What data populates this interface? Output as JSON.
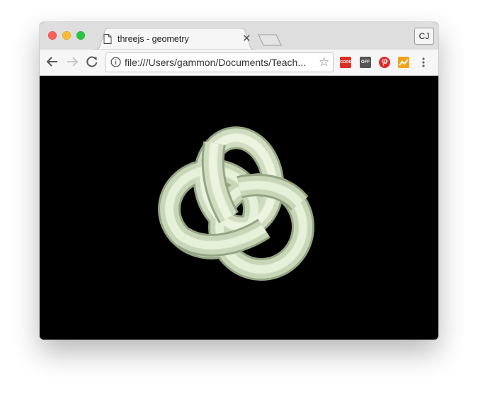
{
  "tab": {
    "title": "threejs - geometry",
    "close_glyph": "✕"
  },
  "profile": {
    "initials": "CJ"
  },
  "address_bar": {
    "url": "file:///Users/gammon/Documents/Teach..."
  },
  "icons": {
    "back": "back-arrow-icon",
    "forward": "forward-arrow-icon",
    "reload": "reload-icon",
    "info": "info-icon",
    "star": "star-icon",
    "menu": "kebab-menu-icon"
  },
  "extensions": {
    "cors_label": "CORS",
    "off_label": "OFF"
  },
  "scene": {
    "background": "#000000",
    "object": "torus-knot",
    "object_color": "#e8f5d8"
  }
}
